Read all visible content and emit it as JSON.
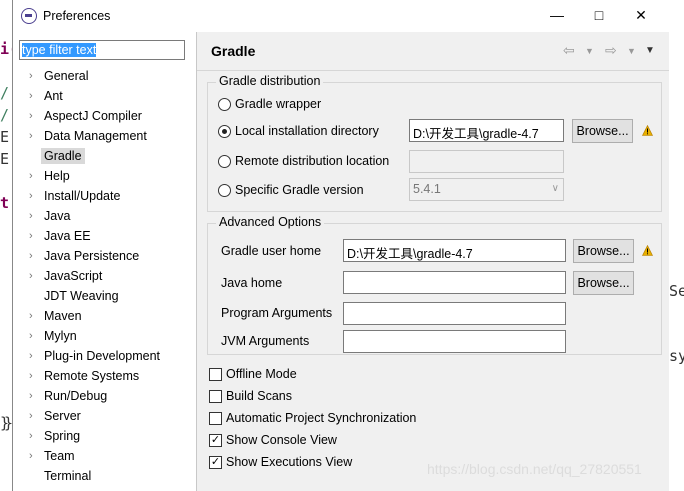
{
  "window": {
    "title": "Preferences"
  },
  "filter": {
    "value": "type filter text"
  },
  "tree": [
    {
      "label": "General",
      "expandable": true
    },
    {
      "label": "Ant",
      "expandable": true
    },
    {
      "label": "AspectJ Compiler",
      "expandable": true
    },
    {
      "label": "Data Management",
      "expandable": true
    },
    {
      "label": "Gradle",
      "expandable": false,
      "selected": true
    },
    {
      "label": "Help",
      "expandable": true
    },
    {
      "label": "Install/Update",
      "expandable": true
    },
    {
      "label": "Java",
      "expandable": true
    },
    {
      "label": "Java EE",
      "expandable": true
    },
    {
      "label": "Java Persistence",
      "expandable": true
    },
    {
      "label": "JavaScript",
      "expandable": true
    },
    {
      "label": "JDT Weaving",
      "expandable": false
    },
    {
      "label": "Maven",
      "expandable": true
    },
    {
      "label": "Mylyn",
      "expandable": true
    },
    {
      "label": "Plug-in Development",
      "expandable": true
    },
    {
      "label": "Remote Systems",
      "expandable": true
    },
    {
      "label": "Run/Debug",
      "expandable": true
    },
    {
      "label": "Server",
      "expandable": true
    },
    {
      "label": "Spring",
      "expandable": true
    },
    {
      "label": "Team",
      "expandable": true
    },
    {
      "label": "Terminal",
      "expandable": false
    }
  ],
  "page": {
    "title": "Gradle"
  },
  "distribution": {
    "group_title": "Gradle distribution",
    "wrapper_label": "Gradle wrapper",
    "local_label": "Local installation directory",
    "local_value": "D:\\开发工具\\gradle-4.7",
    "remote_label": "Remote distribution location",
    "remote_value": "",
    "specific_label": "Specific Gradle version",
    "specific_value": "5.4.1",
    "selected": "local",
    "browse_label": "Browse..."
  },
  "advanced": {
    "group_title": "Advanced Options",
    "user_home_label": "Gradle user home",
    "user_home_value": "D:\\开发工具\\gradle-4.7",
    "java_home_label": "Java home",
    "java_home_value": "",
    "program_args_label": "Program Arguments",
    "program_args_value": "",
    "jvm_args_label": "JVM Arguments",
    "jvm_args_value": "",
    "browse_label": "Browse..."
  },
  "options": {
    "offline_label": "Offline Mode",
    "offline_checked": false,
    "build_scans_label": "Build Scans",
    "build_scans_checked": false,
    "auto_sync_label": "Automatic Project Synchronization",
    "auto_sync_checked": false,
    "console_label": "Show Console View",
    "console_checked": true,
    "executions_label": "Show Executions View",
    "executions_checked": true
  },
  "background": {
    "fragments": [
      "i(",
      "/",
      "/",
      "E",
      "E",
      "t",
      "}",
      "Se",
      "sy",
      "}"
    ]
  },
  "watermark": "https://blog.csdn.net/qq_27820551",
  "colors": {
    "selection": "#3399ff",
    "warning": "#e8b000",
    "keyword": "#7f0055"
  }
}
